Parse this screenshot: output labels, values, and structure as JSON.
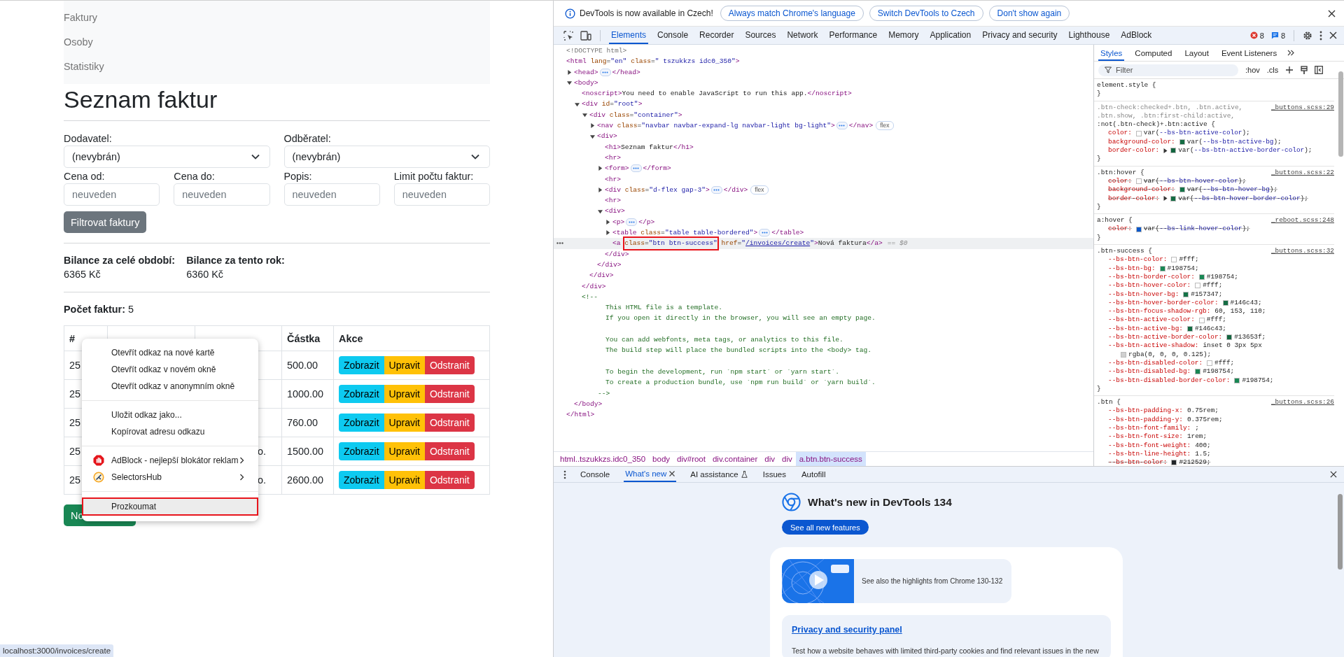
{
  "page": {
    "nav": [
      "Faktury",
      "Osoby",
      "Statistiky"
    ],
    "title": "Seznam faktur",
    "filters": {
      "selects": [
        {
          "label": "Dodavatel:",
          "value": "(nevybrán)"
        },
        {
          "label": "Odběratel:",
          "value": "(nevybrán)"
        }
      ],
      "inputs": [
        {
          "label": "Cena od:",
          "placeholder": "neuveden"
        },
        {
          "label": "Cena do:",
          "placeholder": "neuveden"
        },
        {
          "label": "Popis:",
          "placeholder": "neuveden"
        },
        {
          "label": "Limit počtu faktur:",
          "placeholder": "neuveden"
        }
      ],
      "button": "Filtrovat faktury"
    },
    "balances": [
      {
        "label": "Bilance za celé období:",
        "value": "6365 Kč"
      },
      {
        "label": "Bilance za tento rok:",
        "value": "6360 Kč"
      }
    ],
    "count": "**Počet faktur:** 5",
    "table": {
      "columns": [
        {
          "kind": "label",
          "label": "#"
        },
        {
          "kind": "covered"
        },
        {
          "kind": "covered"
        },
        {
          "kind": "label",
          "label": "Částka"
        },
        {
          "kind": "label",
          "label": "Akce"
        }
      ],
      "rows": [
        {
          "number": "25",
          "amount": "500.00",
          "actions": [
            {
              "kind": "info",
              "label": "Zobrazit"
            },
            {
              "kind": "warning",
              "label": "Upravit"
            },
            {
              "kind": "danger",
              "label": "Odstranit"
            }
          ]
        },
        {
          "number": "25",
          "amount": "1000.00",
          "actions": [
            {
              "kind": "info",
              "label": "Zobrazit"
            },
            {
              "kind": "warning",
              "label": "Upravit"
            },
            {
              "kind": "danger",
              "label": "Odstranit"
            }
          ]
        },
        {
          "number": "25",
          "amount": "760.00",
          "actions": [
            {
              "kind": "info",
              "label": "Zobrazit"
            },
            {
              "kind": "warning",
              "label": "Upravit"
            },
            {
              "kind": "danger",
              "label": "Odstranit"
            }
          ]
        },
        {
          "number": "25",
          "customer": "o.",
          "amount": "1500.00",
          "actions": [
            {
              "kind": "info",
              "label": "Zobrazit"
            },
            {
              "kind": "warning",
              "label": "Upravit"
            },
            {
              "kind": "danger",
              "label": "Odstranit"
            }
          ]
        },
        {
          "number": "25",
          "customer": "o.",
          "amount": "2600.00",
          "actions": [
            {
              "kind": "info",
              "label": "Zobrazit"
            },
            {
              "kind": "warning",
              "label": "Upravit"
            },
            {
              "kind": "danger",
              "label": "Odstranit"
            }
          ]
        }
      ]
    },
    "new_button": "No",
    "context_menu": {
      "groups": [
        [
          {
            "label": "Otevřít odkaz na nové kartě",
            "selected": false
          },
          {
            "label": "Otevřít odkaz v novém okně",
            "selected": false
          },
          {
            "label": "Otevřít odkaz v anonymním okně",
            "selected": false
          }
        ],
        [
          {
            "label": "Uložit odkaz jako...",
            "selected": false
          },
          {
            "label": "Kopírovat adresu odkazu",
            "selected": false
          }
        ],
        [
          {
            "label": "AdBlock - nejlepší blokátor reklam",
            "submenu": true,
            "selected": false
          },
          {
            "label": "SelectorsHub",
            "submenu": true,
            "selected": false
          }
        ],
        [
          {
            "label": "Prozkoumat",
            "selected": true,
            "outlined": true
          }
        ]
      ]
    },
    "status_url": "localhost:3000/invoices/create"
  },
  "devtools": {
    "infobar": {
      "message": "DevTools is now available in Czech!",
      "buttons": [
        "Always match Chrome's language",
        "Switch DevTools to Czech",
        "Don't show again"
      ]
    },
    "tabs": [
      {
        "label": "Elements",
        "selected": true
      },
      {
        "label": "Console",
        "selected": false
      },
      {
        "label": "Recorder",
        "selected": false
      },
      {
        "label": "Sources",
        "selected": false
      },
      {
        "label": "Network",
        "selected": false
      },
      {
        "label": "Performance",
        "selected": false
      },
      {
        "label": "Memory",
        "selected": false
      },
      {
        "label": "Application",
        "selected": false
      },
      {
        "label": "Privacy and security",
        "selected": false
      },
      {
        "label": "Lighthouse",
        "selected": false
      },
      {
        "label": "AdBlock",
        "selected": false
      }
    ],
    "error_count": "8",
    "message_count": "8",
    "dom": [
      {
        "kind": "doctype",
        "text": "<!DOCTYPE html>"
      },
      {
        "kind": "element",
        "open": "<html lang=\"en\" class=\" tszukkzs idc0_350\">",
        "close": "</html>",
        "selected": false,
        "children": [
          {
            "kind": "element",
            "open": "<head>",
            "close": "</head>",
            "expanded": false,
            "ellipsis": true,
            "selected": false
          },
          {
            "kind": "element",
            "open": "<body>",
            "close": "</body>",
            "expanded": true,
            "selected": false,
            "children": [
              {
                "kind": "element",
                "open": "<noscript>You need to enable JavaScript to run this app.</noscript>",
                "selected": false
              },
              {
                "kind": "element",
                "open": "<div id=\"root\">",
                "close": "</div>",
                "expanded": true,
                "selected": false,
                "children": [
                  {
                    "kind": "element",
                    "open": "<div class=\"container\">",
                    "close": "</div>",
                    "expanded": true,
                    "selected": false,
                    "children": [
                      {
                        "kind": "element",
                        "open": "<nav class=\"navbar navbar-expand-lg navbar-light bg-light\">",
                        "close": "</nav>",
                        "expanded": false,
                        "ellipsis": true,
                        "badge": "flex",
                        "selected": false
                      },
                      {
                        "kind": "element",
                        "open": "<div>",
                        "close": "</div>",
                        "expanded": true,
                        "selected": false,
                        "children": [
                          {
                            "kind": "element",
                            "open": "<h1>Seznam faktur</h1>",
                            "selected": false
                          },
                          {
                            "kind": "element",
                            "open": "<hr>",
                            "selected": false
                          },
                          {
                            "kind": "element",
                            "open": "<form>",
                            "close": "</form>",
                            "expanded": false,
                            "ellipsis": true,
                            "selected": false
                          },
                          {
                            "kind": "element",
                            "open": "<hr>",
                            "selected": false
                          },
                          {
                            "kind": "element",
                            "open": "<div class=\"d-flex gap-3\">",
                            "close": "</div>",
                            "expanded": false,
                            "ellipsis": true,
                            "badge": "flex",
                            "selected": false
                          },
                          {
                            "kind": "element",
                            "open": "<hr>",
                            "selected": false
                          },
                          {
                            "kind": "element",
                            "open": "<div>",
                            "close": "</div>",
                            "expanded": true,
                            "selected": false,
                            "children": [
                              {
                                "kind": "element",
                                "open": "<p>",
                                "close": "</p>",
                                "expanded": false,
                                "ellipsis": true,
                                "selected": false
                              },
                              {
                                "kind": "element",
                                "open": "<table class=\"table table-bordered\">",
                                "close": "</table>",
                                "expanded": false,
                                "ellipsis": true,
                                "selected": false
                              },
                              {
                                "kind": "element",
                                "segments": [
                                  {
                                    "text": "<a "
                                  },
                                  {
                                    "text": "class=\"btn btn-success\"",
                                    "outlined": true
                                  },
                                  {
                                    "text": " href=\""
                                  },
                                  {
                                    "text": "/invoices/create",
                                    "link": true
                                  },
                                  {
                                    "text": "\">Nová faktura</a>"
                                  }
                                ],
                                "suffix": "== $0",
                                "selected": true
                              }
                            ]
                          }
                        ]
                      }
                    ]
                  }
                ]
              },
              {
                "kind": "comment",
                "open": "<!--",
                "paragraphs": [
                  [
                    "This HTML file is a template.",
                    "If you open it directly in the browser, you will see an empty page."
                  ],
                  [
                    "You can add webfonts, meta tags, or analytics to this file.",
                    "The build step will place the bundled scripts into the <body> tag."
                  ],
                  [
                    "To begin the development, run `npm start` or `yarn start`.",
                    "To create a production bundle, use `npm run build` or `yarn build`."
                  ]
                ],
                "close": "-->"
              }
            ]
          }
        ]
      }
    ],
    "breadcrumbs": [
      {
        "label": "html..tszukkzs.idc0_350",
        "selected": false
      },
      {
        "label": "body",
        "selected": false
      },
      {
        "label": "div#root",
        "selected": false
      },
      {
        "label": "div.container",
        "selected": false
      },
      {
        "label": "div",
        "selected": false
      },
      {
        "label": "div",
        "selected": false
      },
      {
        "label": "a.btn.btn-success",
        "selected": true
      }
    ],
    "styles": {
      "tabs": [
        {
          "label": "Styles",
          "selected": true
        },
        {
          "label": "Computed",
          "selected": false
        },
        {
          "label": "Layout",
          "selected": false
        },
        {
          "label": "Event Listeners",
          "selected": false
        }
      ],
      "filter_placeholder": "Filter",
      "hov": ":hov",
      "cls": ".cls",
      "rules": [
        {
          "selector_lines": [
            {
              "text": "element.style {",
              "matched": true
            }
          ],
          "close": "}"
        },
        {
          "selector_lines": [
            {
              "text": ".btn-check:checked+.btn, .btn.active,",
              "matched": false
            },
            {
              "text": ".btn.show, .btn:first-child:active,",
              "matched": false
            },
            {
              "text": ":not(.btn-check)+.btn:active {",
              "matched": true
            }
          ],
          "source": "_buttons.scss:29",
          "close": "}",
          "props": [
            {
              "name": "color:",
              "color": "#ffffff",
              "value": "var(--bs-btn-active-color);",
              "struck": false
            },
            {
              "name": "background-color:",
              "color": "#146c43",
              "value": "var(--bs-btn-active-bg);",
              "struck": false
            },
            {
              "name": "border-color:",
              "expandable": true,
              "color": "#13653f",
              "value": "var(--bs-btn-active-border-color);",
              "struck": false
            }
          ]
        },
        {
          "selector_lines": [
            {
              "text": ".btn:hover {",
              "matched": true
            }
          ],
          "source": "_buttons.scss:22",
          "close": "}",
          "props": [
            {
              "name": "color:",
              "color": "#ffffff",
              "value": "var(--bs-btn-hover-color);",
              "struck": true
            },
            {
              "name": "background-color:",
              "color": "#157347",
              "value": "var(--bs-btn-hover-bg);",
              "struck": true
            },
            {
              "name": "border-color:",
              "expandable": true,
              "color": "#146c43",
              "value": "var(--bs-btn-hover-border-color);",
              "struck": true
            }
          ]
        },
        {
          "selector_lines": [
            {
              "text": "a:hover {",
              "matched": true
            }
          ],
          "source": "_reboot.scss:248",
          "close": "}",
          "props": [
            {
              "name": "color:",
              "color": "#0a58ca",
              "value": "var(--bs-link-hover-color);",
              "struck": true
            }
          ]
        },
        {
          "selector_lines": [
            {
              "text": ".btn-success {",
              "matched": true
            }
          ],
          "source": "_buttons.scss:32",
          "close": "}",
          "props": [
            {
              "name": "--bs-btn-color:",
              "color": "#ffffff",
              "value": "#fff;",
              "struck": false
            },
            {
              "name": "--bs-btn-bg:",
              "color": "#198754",
              "value": "#198754;",
              "struck": false
            },
            {
              "name": "--bs-btn-border-color:",
              "color": "#198754",
              "value": "#198754;",
              "struck": false
            },
            {
              "name": "--bs-btn-hover-color:",
              "color": "#ffffff",
              "value": "#fff;",
              "struck": false
            },
            {
              "name": "--bs-btn-hover-bg:",
              "color": "#157347",
              "value": "#157347;",
              "struck": false
            },
            {
              "name": "--bs-btn-hover-border-color:",
              "color": "#146c43",
              "value": "#146c43;",
              "struck": false
            },
            {
              "name": "--bs-btn-focus-shadow-rgb:",
              "value": "60, 153, 110;",
              "struck": false
            },
            {
              "name": "--bs-btn-active-color:",
              "color": "#ffffff",
              "value": "#fff;",
              "struck": false
            },
            {
              "name": "--bs-btn-active-bg:",
              "color": "#146c43",
              "value": "#146c43;",
              "struck": false
            },
            {
              "name": "--bs-btn-active-border-color:",
              "color": "#13653f",
              "value": "#13653f;",
              "struck": false
            },
            {
              "name": "--bs-btn-active-shadow:",
              "value": "inset 0 3px 5px",
              "continuation": {
                "color": "#d0d0d0",
                "value": "rgba(0, 0, 0, 0.125);"
              },
              "struck": false
            },
            {
              "name": "--bs-btn-disabled-color:",
              "color": "#ffffff",
              "value": "#fff;",
              "struck": false
            },
            {
              "name": "--bs-btn-disabled-bg:",
              "color": "#198754",
              "value": "#198754;",
              "struck": false
            },
            {
              "name": "--bs-btn-disabled-border-color:",
              "color": "#198754",
              "value": "#198754;",
              "struck": false
            }
          ]
        },
        {
          "selector_lines": [
            {
              "text": ".btn {",
              "matched": true
            }
          ],
          "source": "_buttons.scss:26",
          "props": [
            {
              "name": "--bs-btn-padding-x:",
              "value": "0.75rem;",
              "struck": false
            },
            {
              "name": "--bs-btn-padding-y:",
              "value": "0.375rem;",
              "struck": false
            },
            {
              "name": "--bs-btn-font-family:",
              "value": ";",
              "struck": false
            },
            {
              "name": "--bs-btn-font-size:",
              "value": "1rem;",
              "struck": false
            },
            {
              "name": "--bs-btn-font-weight:",
              "value": "400;",
              "struck": false
            },
            {
              "name": "--bs-btn-line-height:",
              "value": "1.5;",
              "struck": false
            },
            {
              "name": "--bs-btn-color:",
              "color": "#212529",
              "value": "#212529;",
              "struck": true
            }
          ]
        }
      ]
    },
    "drawer": {
      "tabs": [
        {
          "label": "Console",
          "selected": false
        },
        {
          "label": "What's new",
          "selected": true,
          "closable": true
        },
        {
          "label": "AI assistance",
          "selected": false
        },
        {
          "label": "Issues",
          "selected": false
        },
        {
          "label": "Autofill",
          "selected": false
        }
      ],
      "whats_new": {
        "title": "What's new in DevTools 134",
        "button": "See all new features",
        "highlight_text": "See also the highlights from Chrome 130-132",
        "panel_link": "Privacy and security panel",
        "panel_text": "Test how a website behaves with limited third-party cookies and find relevant issues in the new"
      }
    }
  }
}
